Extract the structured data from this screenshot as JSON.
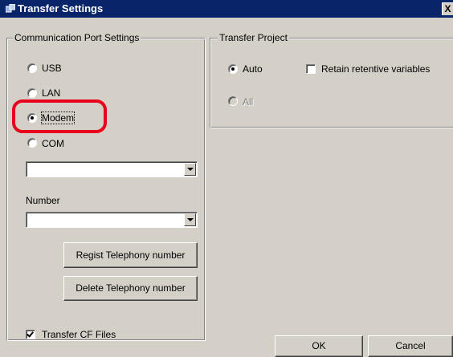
{
  "window": {
    "title": "Transfer Settings",
    "close_glyph": "X",
    "title_icon": "transfer-app-icon"
  },
  "comm_port": {
    "legend": "Communication Port Settings",
    "options": [
      {
        "label": "USB",
        "checked": false
      },
      {
        "label": "LAN",
        "checked": false
      },
      {
        "label": "Modem",
        "checked": true
      },
      {
        "label": "COM",
        "checked": false
      }
    ],
    "port_combo_value": "",
    "number_label": "Number",
    "number_combo_value": "",
    "regist_button": "Regist Telephony number",
    "delete_button": "Delete Telephony number"
  },
  "transfer_project": {
    "legend": "Transfer Project",
    "auto_label": "Auto",
    "auto_checked": true,
    "all_label": "All",
    "all_enabled": false,
    "retain_label": "Retain retentive variables",
    "retain_checked": false
  },
  "transfer_cf": {
    "label": "Transfer CF Files",
    "checked": true
  },
  "buttons": {
    "ok": "OK",
    "cancel": "Cancel"
  },
  "colors": {
    "face": "#d4d0c8",
    "title_bar": "#0a246a",
    "highlight": "#e8001c"
  }
}
